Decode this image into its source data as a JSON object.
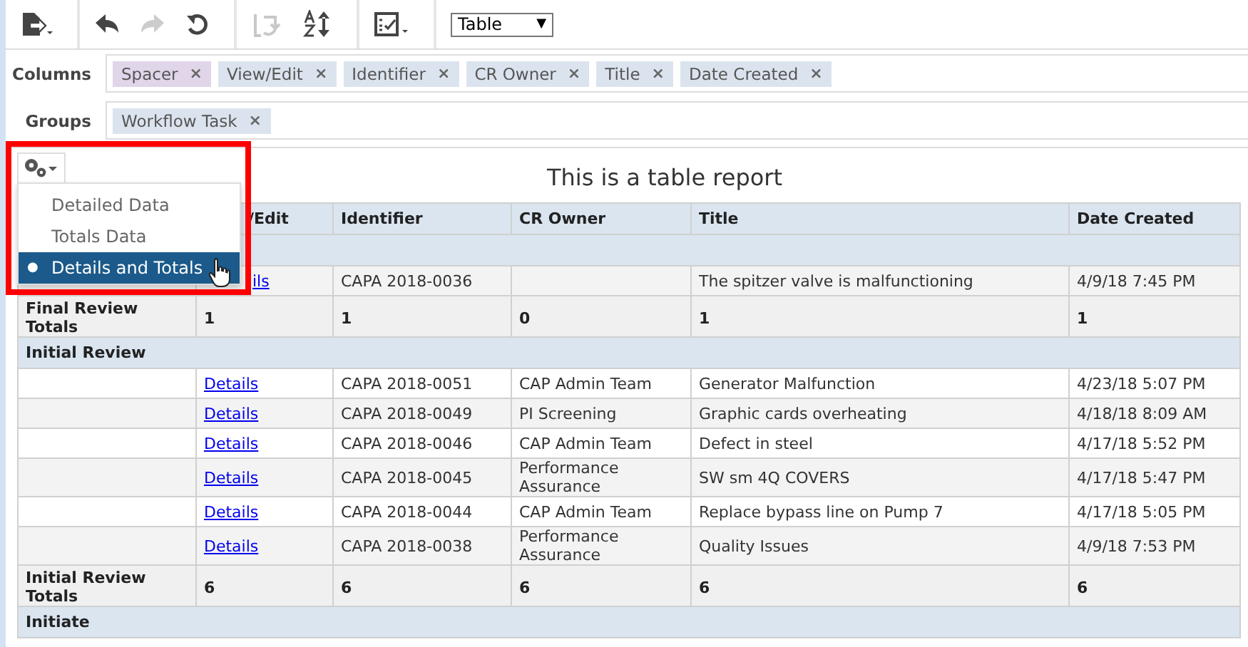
{
  "toolbar": {
    "view_select": {
      "value": "Table",
      "glyph": "▼"
    },
    "redo_disabled": true,
    "swap_disabled": true
  },
  "columns_bar": {
    "label": "Columns",
    "chips": [
      {
        "label": "Spacer",
        "remove": "×",
        "color": "#e1d5ea"
      },
      {
        "label": "View/Edit",
        "remove": "×",
        "color": "#dbe4ee"
      },
      {
        "label": "Identifier",
        "remove": "×",
        "color": "#dbe4ee"
      },
      {
        "label": "CR Owner",
        "remove": "×",
        "color": "#dbe4ee"
      },
      {
        "label": "Title",
        "remove": "×",
        "color": "#dbe4ee"
      },
      {
        "label": "Date Created",
        "remove": "×",
        "color": "#dbe4ee"
      }
    ]
  },
  "groups_bar": {
    "label": "Groups",
    "chips": [
      {
        "label": "Workflow Task",
        "remove": "×",
        "color": "#dbe4ee"
      }
    ]
  },
  "report": {
    "title": "This is a table report",
    "columns": [
      "",
      "/Edit",
      "Identifier",
      "CR Owner",
      "Title",
      "Date Created"
    ],
    "rows": [
      {
        "kind": "group",
        "label": ""
      },
      {
        "kind": "detail",
        "link": "ils",
        "identifier": "CAPA 2018-0036",
        "owner": "",
        "title": "The spitzer valve is malfunctioning",
        "date": "4/9/18 7:45 PM"
      },
      {
        "kind": "total",
        "label": "Final Review Totals",
        "values": [
          "1",
          "1",
          "0",
          "1",
          "1"
        ]
      },
      {
        "kind": "group",
        "label": "Initial Review"
      },
      {
        "kind": "detail",
        "link": "Details",
        "identifier": "CAPA 2018-0051",
        "owner": "CAP Admin Team",
        "title": "Generator Malfunction",
        "date": "4/23/18 5:07 PM"
      },
      {
        "kind": "detail",
        "link": "Details",
        "identifier": "CAPA 2018-0049",
        "owner": "PI Screening",
        "title": "Graphic cards overheating",
        "date": "4/18/18 8:09 AM"
      },
      {
        "kind": "detail",
        "link": "Details",
        "identifier": "CAPA 2018-0046",
        "owner": "CAP Admin Team",
        "title": "Defect in steel",
        "date": "4/17/18 5:52 PM"
      },
      {
        "kind": "detail",
        "link": "Details",
        "identifier": "CAPA 2018-0045",
        "owner": "Performance Assurance",
        "title": "SW sm 4Q COVERS",
        "date": "4/17/18 5:47 PM"
      },
      {
        "kind": "detail",
        "link": "Details",
        "identifier": "CAPA 2018-0044",
        "owner": "CAP Admin Team",
        "title": "Replace bypass line on Pump 7",
        "date": "4/17/18 5:05 PM"
      },
      {
        "kind": "detail",
        "link": "Details",
        "identifier": "CAPA 2018-0038",
        "owner": "Performance Assurance",
        "title": "Quality Issues",
        "date": "4/9/18 7:53 PM"
      },
      {
        "kind": "total",
        "label": "Initial Review Totals",
        "values": [
          "6",
          "6",
          "6",
          "6",
          "6"
        ]
      },
      {
        "kind": "group",
        "label": "Initiate"
      }
    ]
  },
  "display_menu": {
    "items": [
      {
        "label": "Detailed Data",
        "selected": false
      },
      {
        "label": "Totals Data",
        "selected": false
      },
      {
        "label": "Details and Totals",
        "selected": true
      }
    ],
    "bullet": "●"
  }
}
